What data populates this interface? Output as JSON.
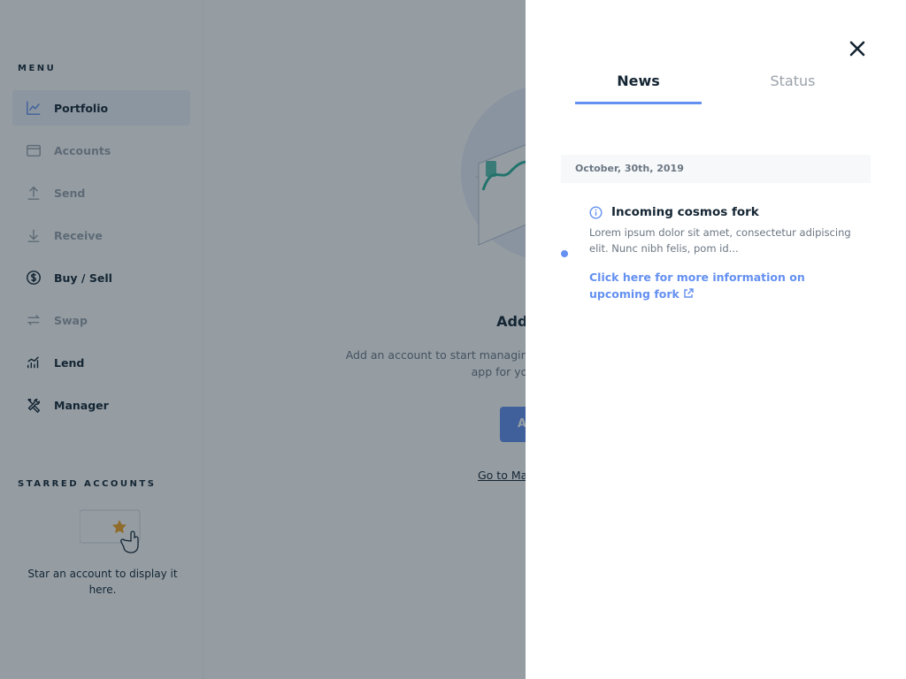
{
  "sidebar": {
    "menu_title": "MENU",
    "items": [
      {
        "label": "Portfolio",
        "icon": "chart-line-icon",
        "state": "active"
      },
      {
        "label": "Accounts",
        "icon": "wallet-icon",
        "state": "disabled"
      },
      {
        "label": "Send",
        "icon": "arrow-up-icon",
        "state": "disabled"
      },
      {
        "label": "Receive",
        "icon": "arrow-down-icon",
        "state": "disabled"
      },
      {
        "label": "Buy / Sell",
        "icon": "dollar-icon",
        "state": "normal"
      },
      {
        "label": "Swap",
        "icon": "swap-icon",
        "state": "disabled"
      },
      {
        "label": "Lend",
        "icon": "lend-icon",
        "state": "normal"
      },
      {
        "label": "Manager",
        "icon": "tools-icon",
        "state": "normal"
      }
    ],
    "starred_title": "STARRED ACCOUNTS",
    "starred_empty": "Star an account to display it here."
  },
  "main": {
    "empty_title": "Add an account",
    "empty_desc": "Add an account to start managing your crypto assets. You need to install the app for your crypto assets first.",
    "add_button": "Add account",
    "manager_link": "Go to Manager"
  },
  "drawer": {
    "tabs": [
      {
        "label": "News",
        "active": true
      },
      {
        "label": "Status",
        "active": false
      }
    ],
    "date": "October, 30th, 2019",
    "news": {
      "title": "Incoming cosmos fork",
      "body": "Lorem ipsum dolor sit amet, consectetur adipiscing elit. Nunc nibh felis, pom id...",
      "link": "Click here for more information on upcoming fork"
    }
  },
  "colors": {
    "accent": "#6490f1",
    "text": "#142533",
    "muted": "#6b7682",
    "overlay": "rgba(20,37,51,0.45)"
  }
}
